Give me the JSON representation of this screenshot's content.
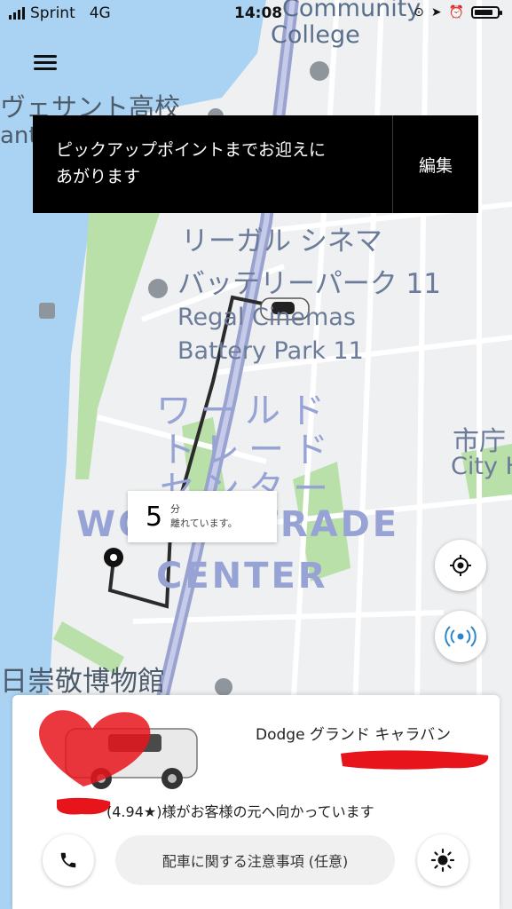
{
  "status_bar": {
    "carrier": "Sprint",
    "network": "4G",
    "time": "14:08"
  },
  "banner": {
    "message_line1": "ピックアップポイントまでお迎えに",
    "message_line2": "あがります",
    "edit_label": "編集"
  },
  "map": {
    "labels": {
      "community": "Community",
      "college": "College",
      "school_jp": "ヴェサント高校",
      "school_partial": "ant",
      "cinema_jp_1": "リーガル シネマ",
      "cinema_jp_2": "バッテリーパーク 11",
      "cinema_en_1": "Regal Cinemas",
      "cinema_en_2": "Battery Park 11",
      "wtc_jp_1": "ワールド",
      "wtc_jp_2": "トレード",
      "wtc_jp_3": "センター",
      "wtc_en_1": "WORLD TRADE",
      "wtc_en_2": "CENTER",
      "cityhall_jp": "市庁",
      "cityhall_en": "City H",
      "museum": "日崇敬博物館"
    },
    "eta": {
      "value": "5",
      "unit": "分",
      "caption": "離れています。"
    }
  },
  "trip": {
    "vehicle": "Dodge グランド キャラバン",
    "driver_status_rating": "(4.94★)",
    "driver_status_text": "様がお客様の元へ向かっています",
    "notes_label": "配車に関する注意事項 (任意)"
  },
  "icons": {
    "menu": "hamburger-menu-icon",
    "locate": "crosshair-icon",
    "safety": "broadcast-icon",
    "phone": "phone-icon",
    "share": "sun-icon"
  }
}
